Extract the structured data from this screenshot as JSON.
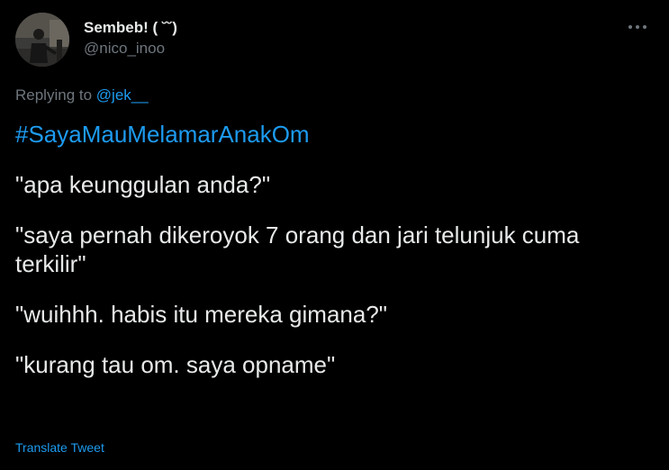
{
  "user": {
    "display_name": "Sembeb! ( ˘˘)",
    "handle": "@nico_inoo"
  },
  "reply": {
    "prefix": "Replying to ",
    "mention": "@jek__"
  },
  "tweet": {
    "hashtag": "#SayaMauMelamarAnakOm",
    "paragraphs": [
      "\"apa keunggulan anda?\"",
      "\"saya pernah dikeroyok 7 orang dan jari telunjuk cuma terkilir\"",
      "\"wuihhh. habis itu mereka gimana?\"",
      "\"kurang tau om. saya opname\""
    ]
  },
  "actions": {
    "translate_label": "Translate Tweet",
    "more_icon": "more-horizontal-icon"
  },
  "colors": {
    "background": "#000000",
    "text": "#e7e9ea",
    "muted": "#6e767d",
    "accent": "#1d9bf0"
  }
}
